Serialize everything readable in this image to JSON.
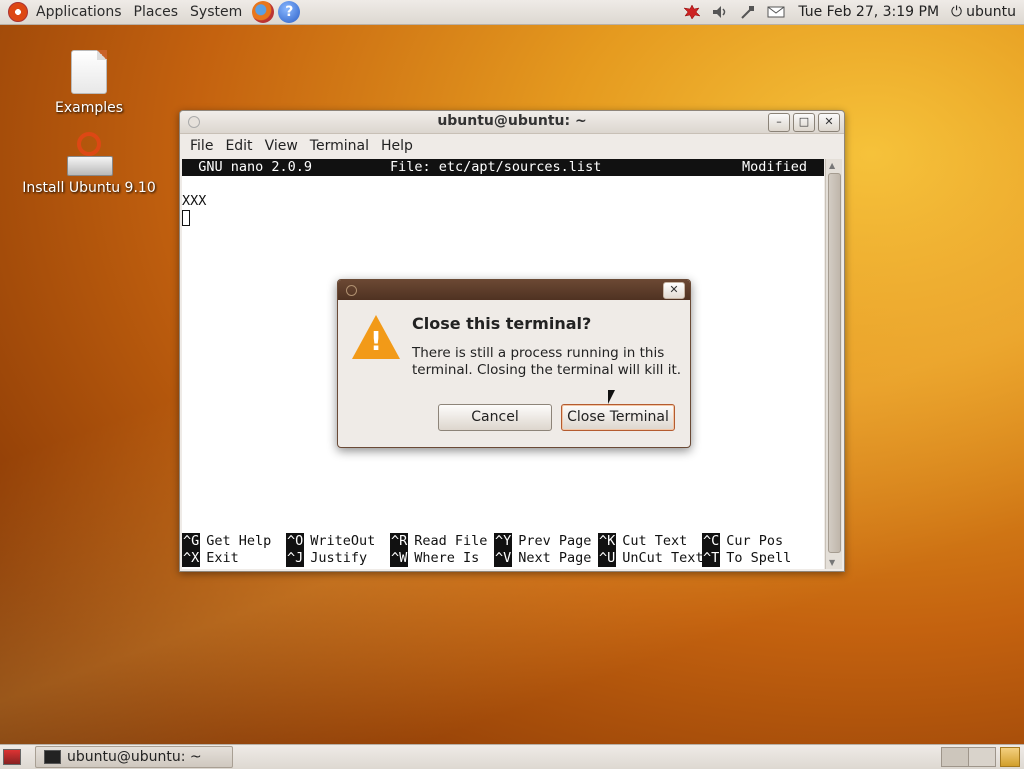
{
  "top_panel": {
    "menus": [
      "Applications",
      "Places",
      "System"
    ],
    "clock": "Tue Feb 27,  3:19 PM",
    "user": "ubuntu"
  },
  "desktop": {
    "icons": [
      {
        "label": "Examples"
      },
      {
        "label": "Install Ubuntu 9.10"
      }
    ]
  },
  "terminal": {
    "title": "ubuntu@ubuntu: ~",
    "menu": [
      "File",
      "Edit",
      "View",
      "Terminal",
      "Help"
    ],
    "nano": {
      "version": "  GNU nano 2.0.9",
      "file": "File: etc/apt/sources.list",
      "status": "Modified",
      "content_line": "XXX"
    },
    "shortcuts_row1": [
      {
        "key": "^G",
        "label": "Get Help"
      },
      {
        "key": "^O",
        "label": "WriteOut"
      },
      {
        "key": "^R",
        "label": "Read File"
      },
      {
        "key": "^Y",
        "label": "Prev Page"
      },
      {
        "key": "^K",
        "label": "Cut Text"
      },
      {
        "key": "^C",
        "label": "Cur Pos"
      }
    ],
    "shortcuts_row2": [
      {
        "key": "^X",
        "label": "Exit"
      },
      {
        "key": "^J",
        "label": "Justify"
      },
      {
        "key": "^W",
        "label": "Where Is"
      },
      {
        "key": "^V",
        "label": "Next Page"
      },
      {
        "key": "^U",
        "label": "UnCut Text"
      },
      {
        "key": "^T",
        "label": "To Spell"
      }
    ]
  },
  "dialog": {
    "heading": "Close this terminal?",
    "body": "There is still a process running in this terminal. Closing the terminal will kill it.",
    "cancel_label": "Cancel",
    "close_label": "Close Terminal",
    "warning_mark": "!"
  },
  "taskbar": {
    "window_button": "ubuntu@ubuntu: ~"
  },
  "icons": {
    "close": "✕",
    "minimize": "–",
    "maximize": "□"
  }
}
